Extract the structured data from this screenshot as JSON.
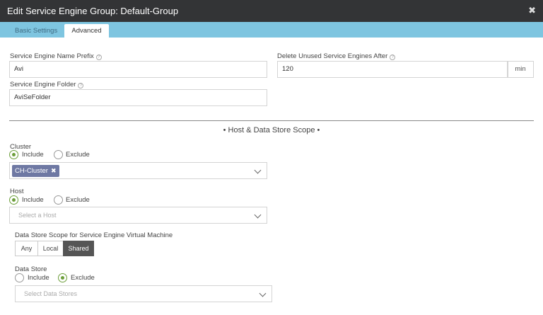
{
  "dialog": {
    "title": "Edit Service Engine Group: Default-Group",
    "close_glyph": "✖"
  },
  "tabs": [
    {
      "label": "Basic Settings"
    },
    {
      "label": "Advanced"
    }
  ],
  "fields": {
    "se_name_prefix": {
      "label": "Service Engine Name Prefix",
      "value": "Avi"
    },
    "se_folder": {
      "label": "Service Engine Folder",
      "value": "AviSeFolder"
    },
    "delete_unused": {
      "label": "Delete Unused Service Engines After",
      "value": "120",
      "unit": "min"
    }
  },
  "section": {
    "title": "• Host & Data Store Scope •"
  },
  "cluster": {
    "label": "Cluster",
    "include_label": "Include",
    "exclude_label": "Exclude",
    "selected_mode": "include",
    "chips": [
      "CH-Cluster"
    ]
  },
  "host": {
    "label": "Host",
    "include_label": "Include",
    "exclude_label": "Exclude",
    "selected_mode": "include",
    "placeholder": "Select a Host"
  },
  "datastore_scope": {
    "label": "Data Store Scope for Service Engine Virtual Machine",
    "options": [
      "Any",
      "Local",
      "Shared"
    ],
    "selected": "Shared"
  },
  "datastore": {
    "label": "Data Store",
    "include_label": "Include",
    "exclude_label": "Exclude",
    "selected_mode": "exclude",
    "placeholder": "Select Data Stores"
  },
  "colors": {
    "titlebar": "#333436",
    "tabbar": "#7ec5e0",
    "radio_active": "#6c9e3a",
    "chip": "#6e78a3",
    "segment_active": "#555555"
  }
}
